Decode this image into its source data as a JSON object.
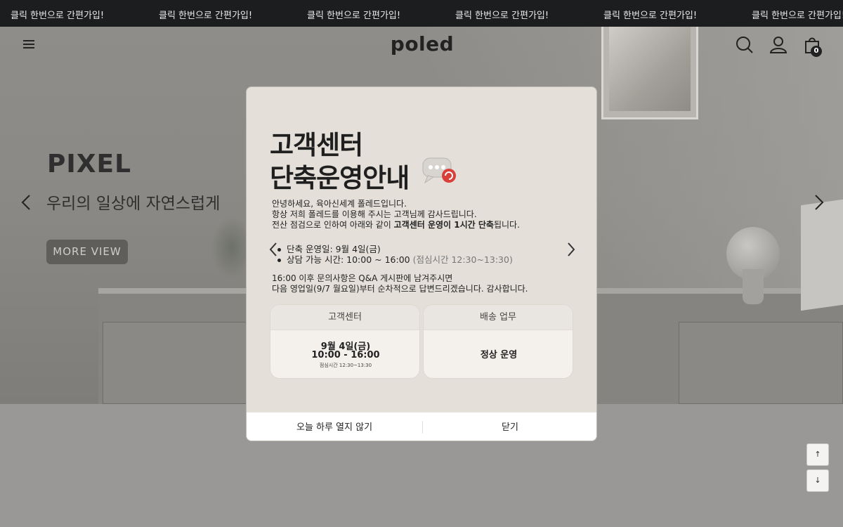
{
  "marquee": {
    "items": [
      "클릭 한번으로 간편가입!",
      "클릭 한번으로 간편가입!",
      "클릭 한번으로 간편가입!",
      "클릭 한번으로 간편가입!",
      "클릭 한번으로 간편가입!",
      "클릭 한번으로 간편가입!"
    ]
  },
  "header": {
    "logo": "poled",
    "cart_count": "0",
    "icons": [
      "menu-icon",
      "search-icon",
      "user-icon",
      "cart-icon"
    ]
  },
  "hero": {
    "title": "PIXEL",
    "subtitle": "우리의 일상에 자연스럽게",
    "button_label": "MORE VIEW"
  },
  "modal": {
    "title_line1": "고객센터",
    "title_line2": "단축운영안내",
    "intro_line1": "안녕하세요, 육아신세계 폴레드입니다.",
    "intro_line2": "항상 저희 폴레드를 이용해 주시는 고객님께 감사드립니다.",
    "intro_line3_pre": "전산 점검으로 인하여 아래와 같이 ",
    "intro_line3_bold": "고객센터 운영이 1시간 단축",
    "intro_line3_post": "됩니다.",
    "bullet1": "단축 운영일: 9월 4일(금)",
    "bullet2": "상담 가능 시간: 10:00 ~ 16:00",
    "bullet2_note": "(점심시간 12:30~13:30)",
    "after_line1": "16:00 이후 문의사항은 Q&A 게시판에 남겨주시면",
    "after_line2": "다음 영업일(9/7 월요일)부터 순차적으로 답변드리겠습니다. 감사합니다.",
    "card1": {
      "header": "고객센터",
      "line1": "9월 4일(금)",
      "line2": "10:00 - 16:00",
      "line3": "점심시간 12:30~13:30"
    },
    "card2": {
      "header": "배송 업무",
      "value": "정상 운영"
    },
    "footer": {
      "dismiss_today": "오늘 하루 열지 않기",
      "close": "닫기"
    }
  },
  "scroll": {
    "up": "↑",
    "down": "↓"
  }
}
